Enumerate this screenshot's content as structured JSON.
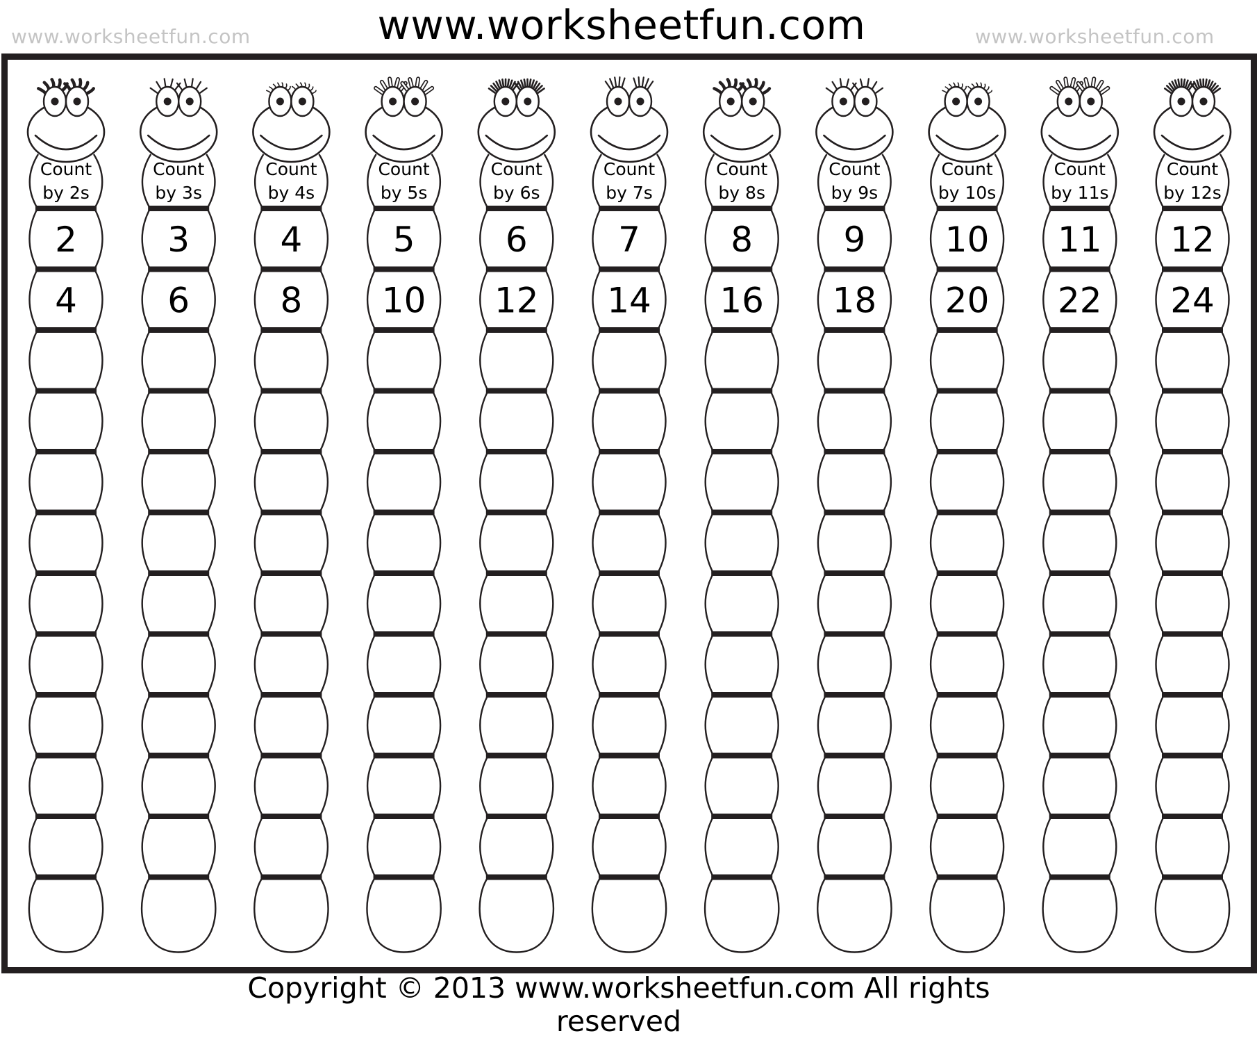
{
  "header": {
    "title": "www.worksheetfun.com",
    "watermark_left": "www.worksheetfun.com",
    "watermark_right": "www.worksheetfun.com"
  },
  "footer": {
    "copyright": "Copyright © 2013 www.worksheetfun.com All rights reserved"
  },
  "worksheet": {
    "label_line1": "Count",
    "blank_segments_per_column": 10,
    "columns": [
      {
        "label": "Count",
        "label2": "by 2s",
        "step": 2,
        "given": [
          "2",
          "4"
        ],
        "lashes": "curly-thick"
      },
      {
        "label": "Count",
        "label2": "by 3s",
        "step": 3,
        "given": [
          "3",
          "6"
        ],
        "lashes": "spiky"
      },
      {
        "label": "Count",
        "label2": "by 4s",
        "step": 4,
        "given": [
          "4",
          "8"
        ],
        "lashes": "tiny-curly"
      },
      {
        "label": "Count",
        "label2": "by 5s",
        "step": 5,
        "given": [
          "5",
          "10"
        ],
        "lashes": "outlined"
      },
      {
        "label": "Count",
        "label2": "by 6s",
        "step": 6,
        "given": [
          "6",
          "12"
        ],
        "lashes": "dense"
      },
      {
        "label": "Count",
        "label2": "by 7s",
        "step": 7,
        "given": [
          "7",
          "14"
        ],
        "lashes": "spiky-short"
      },
      {
        "label": "Count",
        "label2": "by 8s",
        "step": 8,
        "given": [
          "8",
          "16"
        ],
        "lashes": "curly-thick"
      },
      {
        "label": "Count",
        "label2": "by 9s",
        "step": 9,
        "given": [
          "9",
          "18"
        ],
        "lashes": "spiky"
      },
      {
        "label": "Count",
        "label2": "by 10s",
        "step": 10,
        "given": [
          "10",
          "20"
        ],
        "lashes": "tiny-curly"
      },
      {
        "label": "Count",
        "label2": "by 11s",
        "step": 11,
        "given": [
          "11",
          "22"
        ],
        "lashes": "outlined"
      },
      {
        "label": "Count",
        "label2": "by 12s",
        "step": 12,
        "given": [
          "12",
          "24"
        ],
        "lashes": "dense"
      }
    ]
  },
  "colors": {
    "ink": "#231f20",
    "watermark": "#c4c4c4",
    "paper": "#ffffff"
  }
}
